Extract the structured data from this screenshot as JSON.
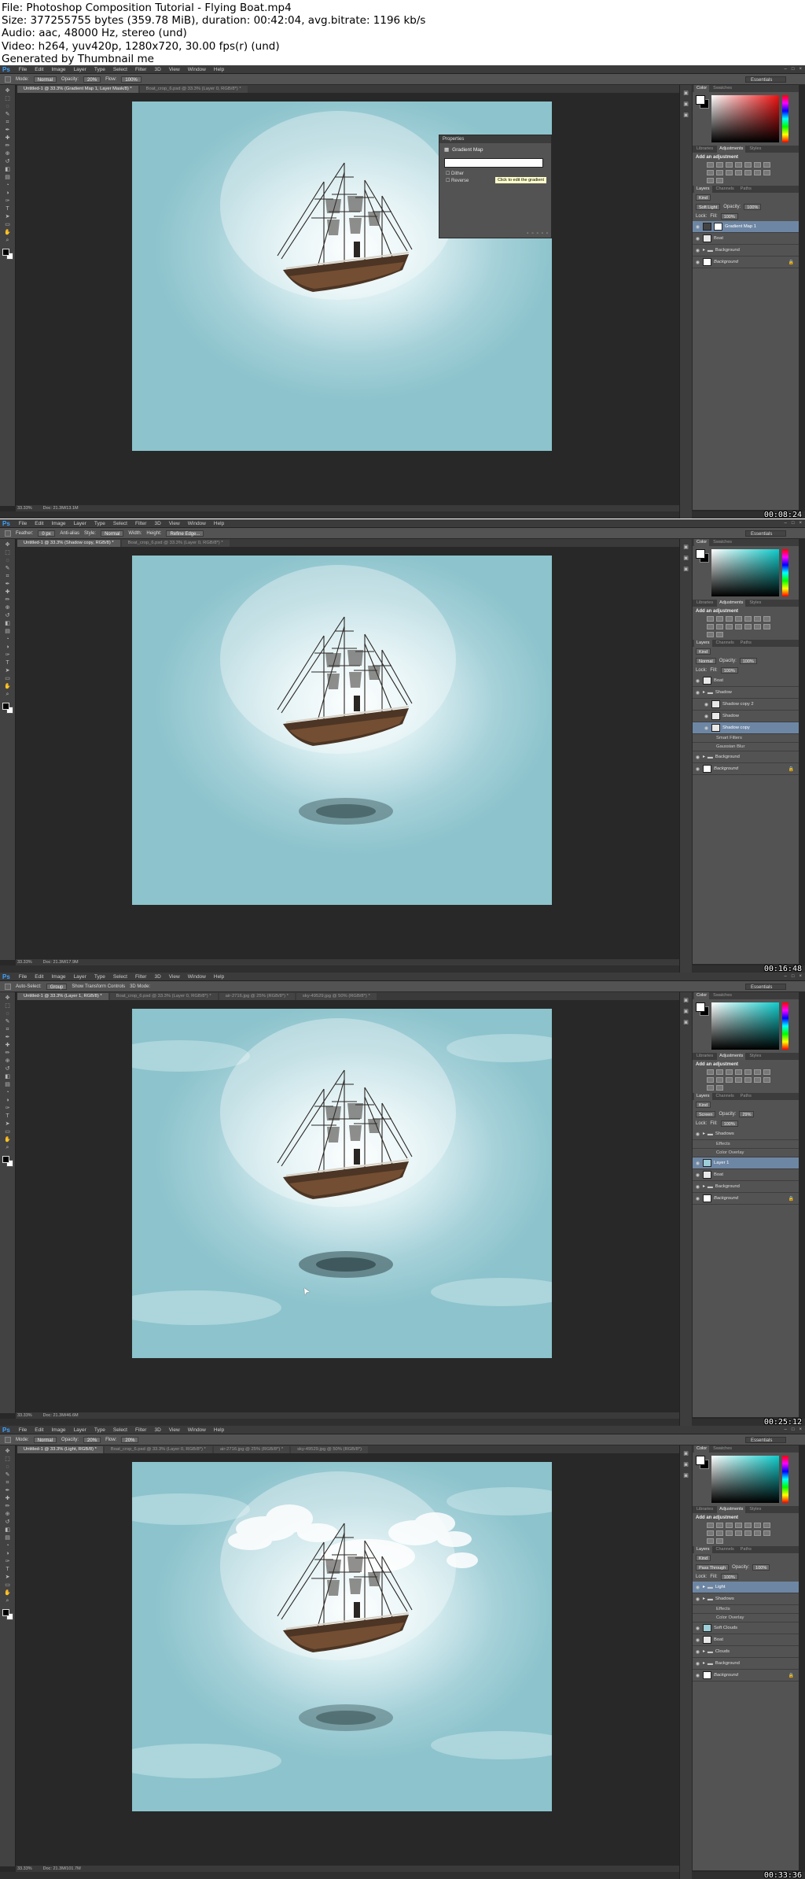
{
  "header": {
    "lines": [
      "File: Photoshop Composition Tutorial - Flying Boat.mp4",
      "Size: 377255755 bytes (359.78 MiB), duration: 00:42:04, avg.bitrate: 1196 kb/s",
      "Audio: aac, 48000 Hz, stereo (und)",
      "Video: h264, yuv420p, 1280x720, 30.00 fps(r) (und)",
      "Generated by Thumbnail me"
    ]
  },
  "app": {
    "logo": "Ps",
    "menus": [
      "File",
      "Edit",
      "Image",
      "Layer",
      "Type",
      "Select",
      "Filter",
      "3D",
      "View",
      "Window",
      "Help"
    ],
    "workspace": "Essentials"
  },
  "frames": [
    {
      "timestamp": "00:08:24",
      "options": {
        "mode_label": "Mode:",
        "mode": "Normal",
        "opacity_label": "Opacity:",
        "opacity": "20%",
        "flow_label": "Flow:",
        "flow": "100%"
      },
      "tabs": [
        "Untitled-1 @ 33.3% (Gradient Map 1, Layer Mask/8) *",
        "Boat_crop_6.psd @ 33.3% (Layer 0, RGB/8*) *"
      ],
      "status": {
        "zoom": "33.33%",
        "doc": "Doc: 21.3M/13.1M"
      },
      "properties": {
        "panel": "Properties",
        "title": "Gradient Map",
        "tooltip": "Click to edit the gradient",
        "dither": "Dither",
        "reverse": "Reverse"
      },
      "layers_blend": "Soft Light",
      "opacity": "100%",
      "fill": "100%",
      "layers": [
        {
          "name": "Gradient Map 1",
          "type": "adjustment",
          "selected": true
        },
        {
          "name": "Boat",
          "type": "layer"
        },
        {
          "name": "Background",
          "type": "group"
        },
        {
          "name": "Background",
          "type": "background",
          "locked": true
        }
      ]
    },
    {
      "timestamp": "00:16:48",
      "options": {
        "feather_label": "Feather:",
        "feather": "0 px",
        "antialias": "Anti-alias",
        "style_label": "Style:",
        "style": "Normal",
        "width_label": "Width:",
        "height_label": "Height:",
        "refine": "Refine Edge..."
      },
      "tabs": [
        "Untitled-1 @ 33.3% (Shadow copy, RGB/8) *",
        "Boat_crop_6.psd @ 33.3% (Layer 0, RGB/8*) *"
      ],
      "status": {
        "zoom": "33.33%",
        "doc": "Doc: 21.3M/17.9M"
      },
      "layers_blend": "Normal",
      "opacity": "100%",
      "fill": "100%",
      "layers": [
        {
          "name": "Boat",
          "type": "layer"
        },
        {
          "name": "Shadow",
          "type": "group"
        },
        {
          "name": "Shadow copy 2",
          "type": "layer",
          "indent": true
        },
        {
          "name": "Shadow",
          "type": "layer",
          "indent": true
        },
        {
          "name": "Shadow copy",
          "type": "smart",
          "indent": true,
          "selected": true
        },
        {
          "name": "Smart Filters",
          "type": "sub"
        },
        {
          "name": "Gaussian Blur",
          "type": "sub"
        },
        {
          "name": "Background",
          "type": "group"
        },
        {
          "name": "Background",
          "type": "background",
          "locked": true
        }
      ]
    },
    {
      "timestamp": "00:25:12",
      "options": {
        "autoselect": "Auto-Select:",
        "group": "Group",
        "transform": "Show Transform Controls",
        "mode3d": "3D Mode:"
      },
      "tabs": [
        "Untitled-1 @ 33.3% (Layer 1, RGB/8) *",
        "Boat_crop_6.psd @ 33.3% (Layer 0, RGB/8*) *",
        "air-2716.jpg @ 25% (RGB/8*) *",
        "sky-49529.jpg @ 50% (RGB/8*) *"
      ],
      "status": {
        "zoom": "33.33%",
        "doc": "Doc: 21.3M/46.6M"
      },
      "layers_blend": "Screen",
      "opacity": "29%",
      "fill": "100%",
      "layers": [
        {
          "name": "Shadows",
          "type": "group"
        },
        {
          "name": "Effects",
          "type": "sub"
        },
        {
          "name": "Color Overlay",
          "type": "sub"
        },
        {
          "name": "Layer 1",
          "type": "layer",
          "selected": true
        },
        {
          "name": "Boat",
          "type": "layer"
        },
        {
          "name": "Background",
          "type": "group"
        },
        {
          "name": "Background",
          "type": "background",
          "locked": true
        }
      ]
    },
    {
      "timestamp": "00:33:36",
      "options": {
        "mode_label": "Mode:",
        "mode": "Normal",
        "opacity_label": "Opacity:",
        "opacity": "20%",
        "flow_label": "Flow:",
        "flow": "20%"
      },
      "tabs": [
        "Untitled-1 @ 33.3% (Light, RGB/8) *",
        "Boat_crop_6.psd @ 33.3% (Layer 0, RGB/8*) *",
        "air-2716.jpg @ 25% (RGB/8*) *",
        "sky-49529.jpg @ 50% (RGB/8*)"
      ],
      "status": {
        "zoom": "33.33%",
        "doc": "Doc: 21.3M/101.7M"
      },
      "layers_blend": "Pass Through",
      "opacity": "100%",
      "fill": "100%",
      "layers": [
        {
          "name": "Light",
          "type": "group",
          "selected": true
        },
        {
          "name": "Shadows",
          "type": "group"
        },
        {
          "name": "Effects",
          "type": "sub"
        },
        {
          "name": "Color Overlay",
          "type": "sub"
        },
        {
          "name": "Soft Clouds",
          "type": "layer"
        },
        {
          "name": "Boat",
          "type": "layer"
        },
        {
          "name": "Clouds",
          "type": "group"
        },
        {
          "name": "Background",
          "type": "group"
        },
        {
          "name": "Background",
          "type": "background",
          "locked": true
        }
      ]
    }
  ],
  "panels": {
    "color_tabs": [
      "Color",
      "Swatches"
    ],
    "adj_tabs": [
      "Libraries",
      "Adjustments",
      "Styles"
    ],
    "add_adjustment": "Add an adjustment",
    "layer_tabs": [
      "Layers",
      "Channels",
      "Paths"
    ],
    "kind": "Kind",
    "opacity_label": "Opacity:",
    "fill_label": "Fill:",
    "lock_label": "Lock:"
  },
  "colors": {
    "selection": "#6d86a4",
    "ps_blue": "#3ea2ff",
    "bg_dark": "#282828",
    "panel": "#535353"
  }
}
